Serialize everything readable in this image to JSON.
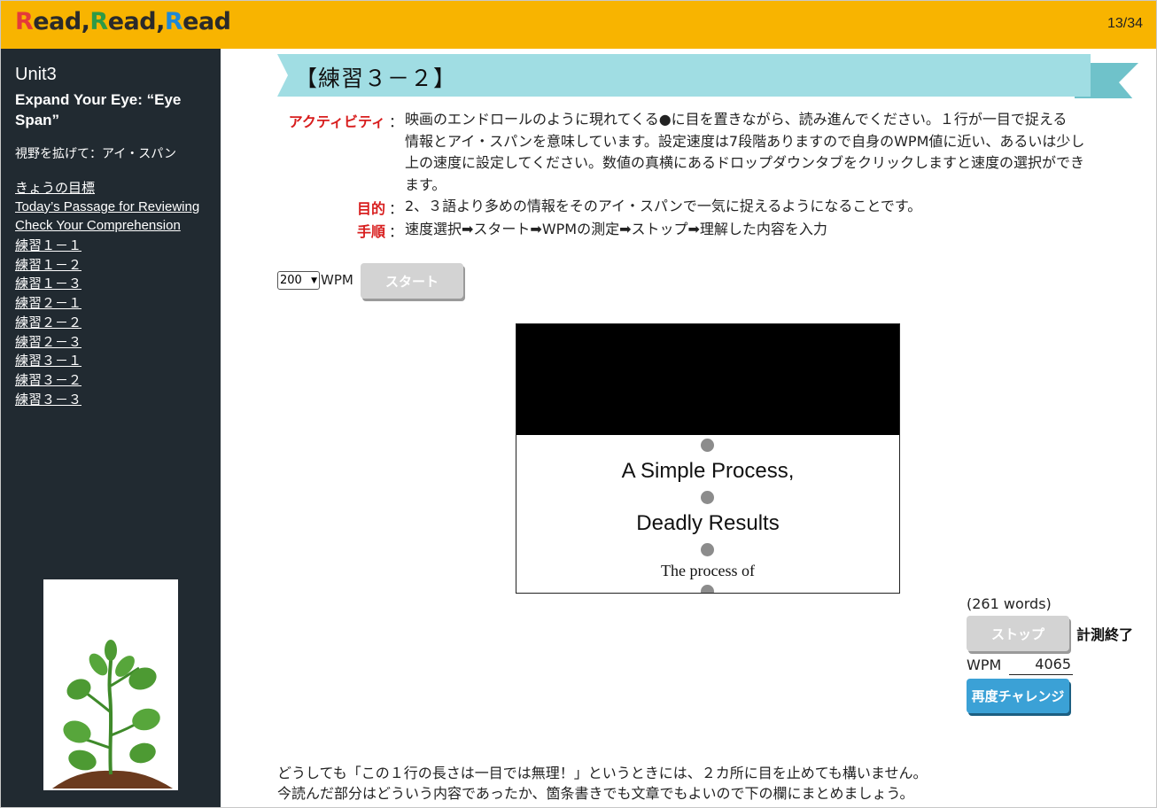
{
  "header": {
    "logo_parts": [
      {
        "text": "R",
        "color": "#e53a3a"
      },
      {
        "text": "ead",
        "color": "#2a2a2a"
      },
      {
        "text": ",",
        "color": "#2a2a2a"
      },
      {
        "text": "R",
        "color": "#2e9a47"
      },
      {
        "text": "ead",
        "color": "#2a2a2a"
      },
      {
        "text": ",",
        "color": "#2a2a2a"
      },
      {
        "text": "R",
        "color": "#1e88d6"
      },
      {
        "text": "ead",
        "color": "#2a2a2a"
      }
    ],
    "page_counter": "13/34",
    "bar_color": "#f8b400"
  },
  "sidebar": {
    "unit": "Unit3",
    "title": "Expand Your Eye: “Eye Span”",
    "subtitle": "視野を拡げて：アイ・スパン",
    "nav": [
      "きょうの目標",
      "Today’s Passage for Reviewing",
      "Check Your Comprehension",
      "練習１－１",
      "練習１－２",
      "練習１－３",
      "練習２－１",
      "練習２－２",
      "練習２－３",
      "練習３－１",
      "練習３－２",
      "練習３－３"
    ],
    "background": "#212a31"
  },
  "main": {
    "title": "【練習３－２】",
    "activity_label": "アクティビティ",
    "purpose_label": "目的",
    "steps_label": "手順",
    "colon": "：",
    "activity_lines": [
      "映画のエンドロールのように現れてくる●に目を置きながら、読み進んでください。１行が一目で捉える",
      "情報とアイ・スパンを意味しています。設定速度は7段階ありますので自身のWPM値に近い、あるいは少し",
      "上の速度に設定してください。数値の真横にあるドロップダウンタブをクリックしますと速度の選択ができ",
      "ます。"
    ],
    "purpose": "2、３語より多めの情報をそのアイ・スパンで一気に捉えるようになることです。",
    "steps": "速度選択➡スタート➡WPMの測定➡ストップ➡理解した内容を入力",
    "speed_select_value": "200",
    "speed_unit": "WPM",
    "start_button": "スタート",
    "viewer": {
      "line1": "A Simple Process,",
      "line2": "Deadly Results",
      "line3": "The process of"
    },
    "word_count": "(261 words)",
    "stop_button": "ストップ",
    "stop_status": "計測終了",
    "wpm_label": "WPM",
    "wpm_value": "4065",
    "retry_button": "再度チャレンジ",
    "note_line1": "どうしても「この１行の長さは一目では無理！」というときには、２カ所に目を止めても構いません。",
    "note_line2": "今読んだ部分はどういう内容であったか、箇条書きでも文章でもよいので下の欄にまとめましょう。"
  },
  "icons": {
    "sidebar_illustration": "sprout-illustration",
    "select_arrow": "chevron-down-icon",
    "banner": "ribbon-banner"
  }
}
